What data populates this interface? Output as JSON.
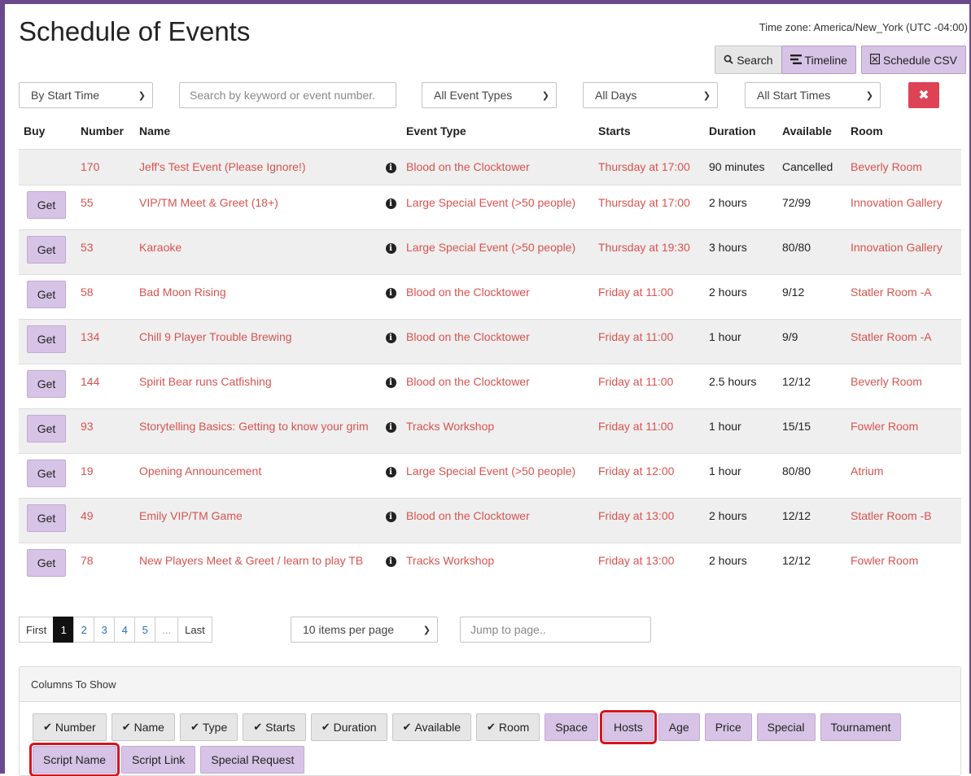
{
  "header": {
    "title": "Schedule of Events",
    "timezone": "Time zone: America/New_York (UTC -04:00)",
    "search_label": "Search",
    "timeline_label": "Timeline",
    "csv_label": "Schedule CSV"
  },
  "filters": {
    "sort": "By Start Time",
    "search_placeholder": "Search by keyword or event number.",
    "event_types": "All Event Types",
    "days": "All Days",
    "start_times": "All Start Times",
    "clear_label": "✖"
  },
  "table": {
    "headers": {
      "buy": "Buy",
      "number": "Number",
      "name": "Name",
      "event_type": "Event Type",
      "starts": "Starts",
      "duration": "Duration",
      "available": "Available",
      "room": "Room"
    },
    "get_label": "Get",
    "rows": [
      {
        "number": "170",
        "name": "Jeff's Test Event (Please Ignore!)",
        "type": "Blood on the Clocktower",
        "starts": "Thursday at 17:00",
        "duration": "90 minutes",
        "available": "Cancelled",
        "room": "Beverly Room"
      },
      {
        "number": "55",
        "name": "VIP/TM Meet & Greet (18+)",
        "type": "Large Special Event (>50 people)",
        "starts": "Thursday at 17:00",
        "duration": "2 hours",
        "available": "72/99",
        "room": "Innovation Gallery"
      },
      {
        "number": "53",
        "name": "Karaoke",
        "type": "Large Special Event (>50 people)",
        "starts": "Thursday at 19:30",
        "duration": "3 hours",
        "available": "80/80",
        "room": "Innovation Gallery"
      },
      {
        "number": "58",
        "name": "Bad Moon Rising",
        "type": "Blood on the Clocktower",
        "starts": "Friday at 11:00",
        "duration": "2 hours",
        "available": "9/12",
        "room": "Statler Room -A"
      },
      {
        "number": "134",
        "name": "Chill 9 Player Trouble Brewing",
        "type": "Blood on the Clocktower",
        "starts": "Friday at 11:00",
        "duration": "1 hour",
        "available": "9/9",
        "room": "Statler Room -A"
      },
      {
        "number": "144",
        "name": "Spirit Bear runs Catfishing",
        "type": "Blood on the Clocktower",
        "starts": "Friday at 11:00",
        "duration": "2.5 hours",
        "available": "12/12",
        "room": "Beverly Room"
      },
      {
        "number": "93",
        "name": "Storytelling Basics: Getting to know your grim",
        "type": "Tracks Workshop",
        "starts": "Friday at 11:00",
        "duration": "1 hour",
        "available": "15/15",
        "room": "Fowler Room"
      },
      {
        "number": "19",
        "name": "Opening Announcement",
        "type": "Large Special Event (>50 people)",
        "starts": "Friday at 12:00",
        "duration": "1 hour",
        "available": "80/80",
        "room": "Atrium"
      },
      {
        "number": "49",
        "name": "Emily VIP/TM Game",
        "type": "Blood on the Clocktower",
        "starts": "Friday at 13:00",
        "duration": "2 hours",
        "available": "12/12",
        "room": "Statler Room -B"
      },
      {
        "number": "78",
        "name": "New Players Meet & Greet / learn to play TB",
        "type": "Tracks Workshop",
        "starts": "Friday at 13:00",
        "duration": "2 hours",
        "available": "12/12",
        "room": "Fowler Room"
      }
    ]
  },
  "pager": {
    "first": "First",
    "pages": [
      "1",
      "2",
      "3",
      "4",
      "5",
      "..."
    ],
    "last": "Last",
    "per_page": "10 items per page",
    "jump_placeholder": "Jump to page.."
  },
  "columns_panel": {
    "title": "Columns To Show",
    "checked": [
      "Number",
      "Name",
      "Type",
      "Starts",
      "Duration",
      "Available",
      "Room"
    ],
    "unchecked": [
      "Space",
      "Hosts",
      "Age",
      "Price",
      "Special",
      "Tournament",
      "Script Name",
      "Script Link",
      "Special Request"
    ],
    "highlighted": [
      "Hosts",
      "Script Name"
    ]
  }
}
